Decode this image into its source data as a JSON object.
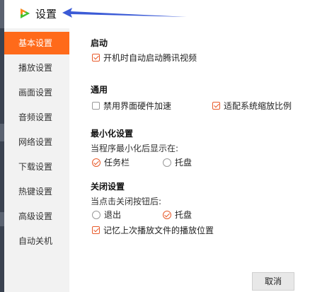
{
  "window": {
    "title": "设置"
  },
  "sidebar": {
    "items": [
      {
        "label": "基本设置",
        "active": true
      },
      {
        "label": "播放设置",
        "active": false
      },
      {
        "label": "画面设置",
        "active": false
      },
      {
        "label": "音频设置",
        "active": false
      },
      {
        "label": "网络设置",
        "active": false
      },
      {
        "label": "下载设置",
        "active": false
      },
      {
        "label": "热键设置",
        "active": false
      },
      {
        "label": "高级设置",
        "active": false
      },
      {
        "label": "自动关机",
        "active": false
      }
    ]
  },
  "startup": {
    "title": "启动",
    "autostart": {
      "label": "开机时自动启动腾讯视频",
      "checked": true
    }
  },
  "general": {
    "title": "通用",
    "disable_hw_accel": {
      "label": "禁用界面硬件加速",
      "checked": false
    },
    "system_scale": {
      "label": "适配系统缩放比例",
      "checked": true
    }
  },
  "minimize": {
    "title": "最小化设置",
    "hint": "当程序最小化后显示在:",
    "taskbar": {
      "label": "任务栏",
      "selected": true
    },
    "tray": {
      "label": "托盘",
      "selected": false
    }
  },
  "close": {
    "title": "关闭设置",
    "hint": "当点击关闭按钮后:",
    "exit": {
      "label": "退出",
      "selected": false
    },
    "tray": {
      "label": "托盘",
      "selected": true
    },
    "remember": {
      "label": "记忆上次播放文件的播放位置",
      "checked": true
    }
  },
  "footer": {
    "cancel_label": "取消"
  },
  "colors": {
    "accent": "#ff6a1a",
    "check": "#e85a2a",
    "sidebar_bg": "#f2f2f2",
    "arrow": "#3b5bd6"
  }
}
